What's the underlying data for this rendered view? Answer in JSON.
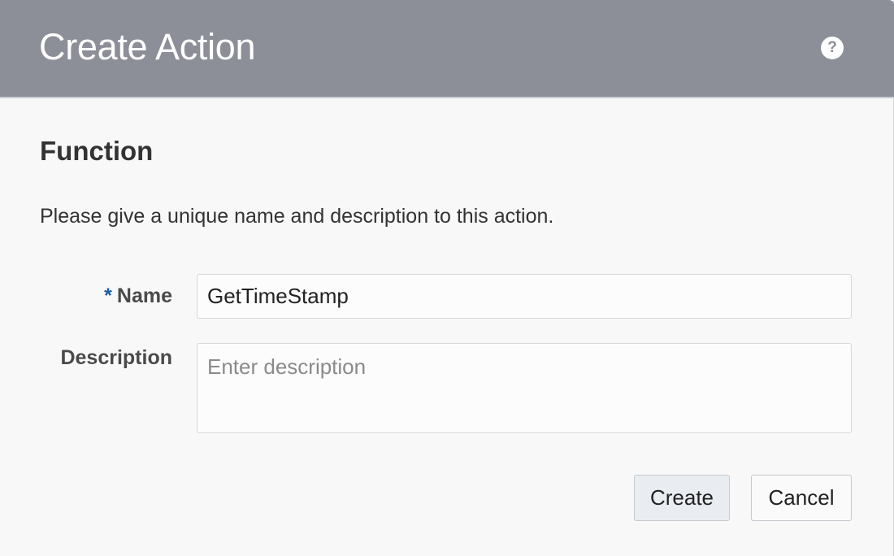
{
  "dialog": {
    "title": "Create Action",
    "help_icon": "question-circle-icon",
    "help_glyph": "?"
  },
  "section": {
    "title": "Function",
    "intro": "Please give a unique name and description to this action."
  },
  "form": {
    "name": {
      "required_marker": "*",
      "label": "Name",
      "value": "GetTimeStamp"
    },
    "description": {
      "label": "Description",
      "value": "",
      "placeholder": "Enter description"
    }
  },
  "buttons": {
    "create_label": "Create",
    "cancel_label": "Cancel"
  },
  "colors": {
    "header_bg": "#8c8e98",
    "body_bg": "#f8f8f8",
    "required_accent": "#1a5aa3"
  }
}
